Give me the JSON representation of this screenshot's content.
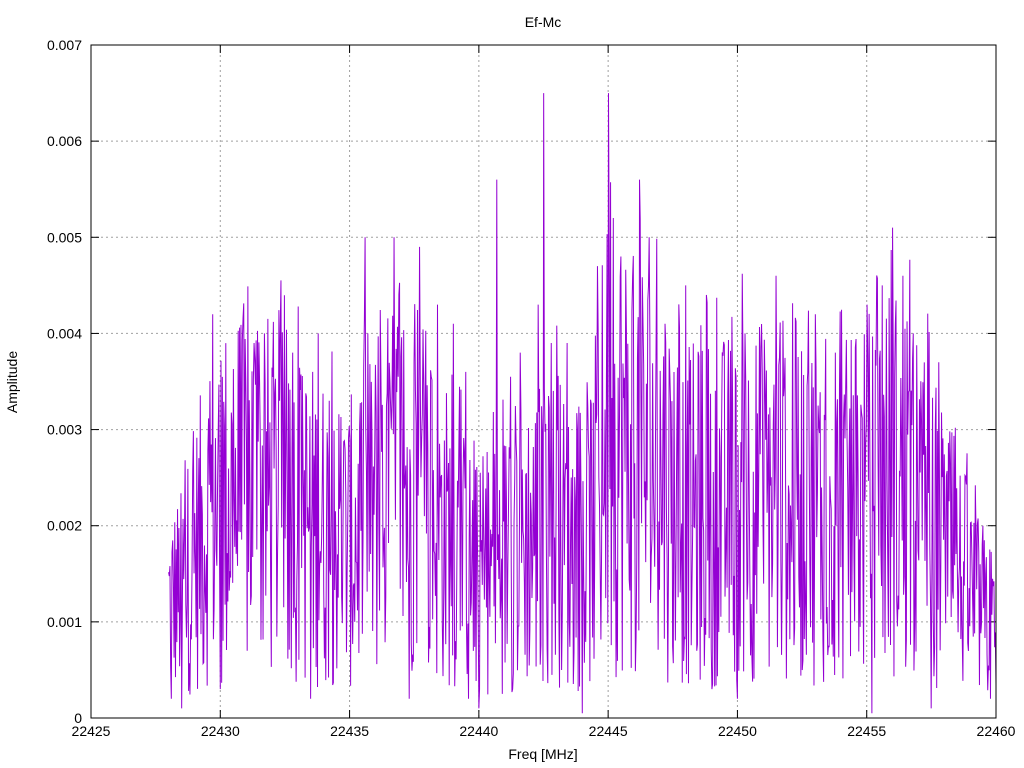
{
  "chart_data": {
    "type": "line",
    "title": "Ef-Mc",
    "xlabel": "Freq [MHz]",
    "ylabel": "Amplitude",
    "xlim": [
      22425,
      22460
    ],
    "ylim": [
      0,
      0.007
    ],
    "x_ticks": [
      22425,
      22430,
      22435,
      22440,
      22445,
      22450,
      22455,
      22460
    ],
    "y_ticks": [
      0,
      0.001,
      0.002,
      0.003,
      0.004,
      0.005,
      0.006,
      0.007
    ],
    "x_tick_labels": [
      "22425",
      "22430",
      "22435",
      "22440",
      "22445",
      "22450",
      "22455",
      "22460"
    ],
    "y_tick_labels": [
      "0",
      "0.001",
      "0.002",
      "0.003",
      "0.004",
      "0.005",
      "0.006",
      "0.007"
    ],
    "grid": true,
    "legend": "none",
    "series": [
      {
        "color": "#9400d3",
        "x_start": 22428,
        "x_end": 22460,
        "approx_samples": 1200,
        "envelope_points": [
          {
            "x": 22428.0,
            "y": 0.0012
          },
          {
            "x": 22428.5,
            "y": 0.0013
          },
          {
            "x": 22429.2,
            "y": 0.0018
          },
          {
            "x": 22429.7,
            "y": 0.0022
          },
          {
            "x": 22431.3,
            "y": 0.0024
          },
          {
            "x": 22433.0,
            "y": 0.0021
          },
          {
            "x": 22435.0,
            "y": 0.0018
          },
          {
            "x": 22437.0,
            "y": 0.0025
          },
          {
            "x": 22438.5,
            "y": 0.002
          },
          {
            "x": 22440.0,
            "y": 0.0014
          },
          {
            "x": 22441.5,
            "y": 0.0018
          },
          {
            "x": 22443.0,
            "y": 0.002
          },
          {
            "x": 22444.0,
            "y": 0.0015
          },
          {
            "x": 22445.0,
            "y": 0.0028
          },
          {
            "x": 22446.5,
            "y": 0.0027
          },
          {
            "x": 22448.0,
            "y": 0.0021
          },
          {
            "x": 22450.0,
            "y": 0.0022
          },
          {
            "x": 22452.0,
            "y": 0.0023
          },
          {
            "x": 22454.0,
            "y": 0.0021
          },
          {
            "x": 22456.0,
            "y": 0.0025
          },
          {
            "x": 22457.5,
            "y": 0.002
          },
          {
            "x": 22459.0,
            "y": 0.0013
          },
          {
            "x": 22460.0,
            "y": 0.0008
          }
        ],
        "peaks": [
          {
            "x": 22429.7,
            "y": 0.0042
          },
          {
            "x": 22431.3,
            "y": 0.0039
          },
          {
            "x": 22431.7,
            "y": 0.004
          },
          {
            "x": 22432.3,
            "y": 0.0033
          },
          {
            "x": 22432.8,
            "y": 0.0038
          },
          {
            "x": 22433.8,
            "y": 0.004
          },
          {
            "x": 22434.2,
            "y": 0.0033
          },
          {
            "x": 22435.6,
            "y": 0.005
          },
          {
            "x": 22435.7,
            "y": 0.004
          },
          {
            "x": 22437.5,
            "y": 0.0037
          },
          {
            "x": 22437.7,
            "y": 0.0049
          },
          {
            "x": 22438.4,
            "y": 0.0043
          },
          {
            "x": 22439.0,
            "y": 0.0041
          },
          {
            "x": 22439.5,
            "y": 0.0036
          },
          {
            "x": 22440.7,
            "y": 0.0056
          },
          {
            "x": 22441.6,
            "y": 0.0038
          },
          {
            "x": 22442.3,
            "y": 0.0043
          },
          {
            "x": 22442.5,
            "y": 0.0065
          },
          {
            "x": 22442.8,
            "y": 0.0039
          },
          {
            "x": 22443.4,
            "y": 0.0039
          },
          {
            "x": 22444.6,
            "y": 0.0047
          },
          {
            "x": 22445.0,
            "y": 0.0065
          },
          {
            "x": 22445.2,
            "y": 0.0052
          },
          {
            "x": 22445.5,
            "y": 0.0048
          },
          {
            "x": 22446.2,
            "y": 0.0056
          },
          {
            "x": 22446.6,
            "y": 0.005
          },
          {
            "x": 22447.2,
            "y": 0.0041
          },
          {
            "x": 22448.0,
            "y": 0.0045
          },
          {
            "x": 22448.8,
            "y": 0.0044
          },
          {
            "x": 22450.3,
            "y": 0.004
          },
          {
            "x": 22451.5,
            "y": 0.0046
          },
          {
            "x": 22453.0,
            "y": 0.0042
          },
          {
            "x": 22453.8,
            "y": 0.0038
          },
          {
            "x": 22455.0,
            "y": 0.0043
          },
          {
            "x": 22455.6,
            "y": 0.0045
          },
          {
            "x": 22456.0,
            "y": 0.0051
          },
          {
            "x": 22456.4,
            "y": 0.0046
          },
          {
            "x": 22456.8,
            "y": 0.004
          },
          {
            "x": 22457.8,
            "y": 0.0037
          },
          {
            "x": 22459.5,
            "y": 0.002
          }
        ],
        "dips": [
          {
            "x": 22428.1,
            "y": 0.0002
          },
          {
            "x": 22428.5,
            "y": 0.0001
          },
          {
            "x": 22430.0,
            "y": 0.0003
          },
          {
            "x": 22433.5,
            "y": 0.0002
          },
          {
            "x": 22437.3,
            "y": 0.0002
          },
          {
            "x": 22439.6,
            "y": 0.0002
          },
          {
            "x": 22440.0,
            "y": 0.0001
          },
          {
            "x": 22441.3,
            "y": 0.0003
          },
          {
            "x": 22444.0,
            "y": 5e-05
          },
          {
            "x": 22449.0,
            "y": 0.0003
          },
          {
            "x": 22450.0,
            "y": 0.0002
          },
          {
            "x": 22455.2,
            "y": 5e-05
          },
          {
            "x": 22457.5,
            "y": 0.0001
          },
          {
            "x": 22459.8,
            "y": 0.0002
          }
        ]
      }
    ]
  }
}
